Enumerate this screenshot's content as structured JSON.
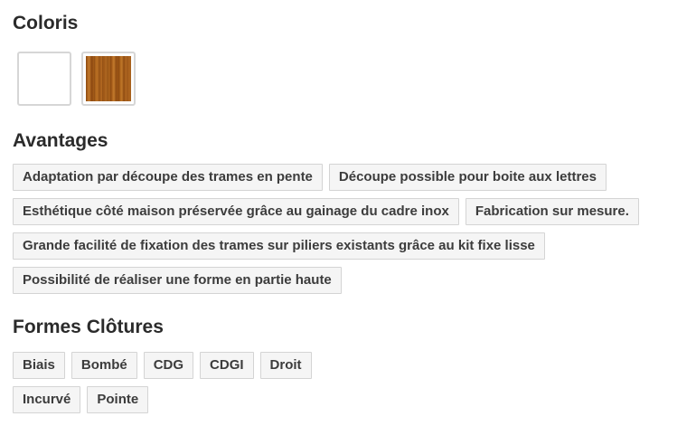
{
  "coloris": {
    "title": "Coloris",
    "swatches": [
      {
        "name": "white",
        "color": "#ffffff"
      },
      {
        "name": "wood",
        "color": "#a85f1a"
      }
    ]
  },
  "avantages": {
    "title": "Avantages",
    "tags": [
      "Adaptation par découpe des trames en pente",
      "Découpe possible pour boite aux lettres",
      "Esthétique côté maison préservée grâce au gainage du cadre inox",
      "Fabrication sur mesure.",
      "Grande facilité de fixation des trames sur piliers existants grâce au kit fixe lisse",
      "Possibilité de réaliser une forme en partie haute"
    ]
  },
  "formes": {
    "title": "Formes Clôtures",
    "tags": [
      "Biais",
      "Bombé",
      "CDG",
      "CDGI",
      "Droit",
      "Incurvé",
      "Pointe"
    ]
  }
}
